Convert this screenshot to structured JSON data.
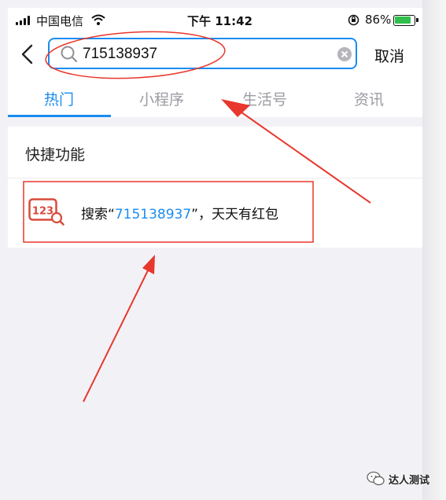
{
  "status_bar": {
    "carrier": "中国电信",
    "time": "下午 11:42",
    "battery_percent": "86%",
    "battery_level": 0.86,
    "icons": [
      "signal-icon",
      "wifi-icon",
      "orientation-lock-icon",
      "battery-charging-icon"
    ]
  },
  "search": {
    "query": "715138937",
    "cancel_label": "取消",
    "icons": [
      "back-chevron-icon",
      "search-icon",
      "clear-icon"
    ]
  },
  "tabs": [
    {
      "label": "热门",
      "active": true
    },
    {
      "label": "小程序",
      "active": false
    },
    {
      "label": "生活号",
      "active": false
    },
    {
      "label": "资讯",
      "active": false
    }
  ],
  "section": {
    "title": "快捷功能",
    "shortcut": {
      "icon_text": "123",
      "prefix": "搜索“",
      "number": "715138937",
      "suffix": "”，天天有红包"
    }
  },
  "watermark": {
    "text": "达人测试"
  },
  "colors": {
    "accent": "#1b8cf0",
    "annotation_red": "#e8372c",
    "icon_red": "#d94a3b"
  }
}
